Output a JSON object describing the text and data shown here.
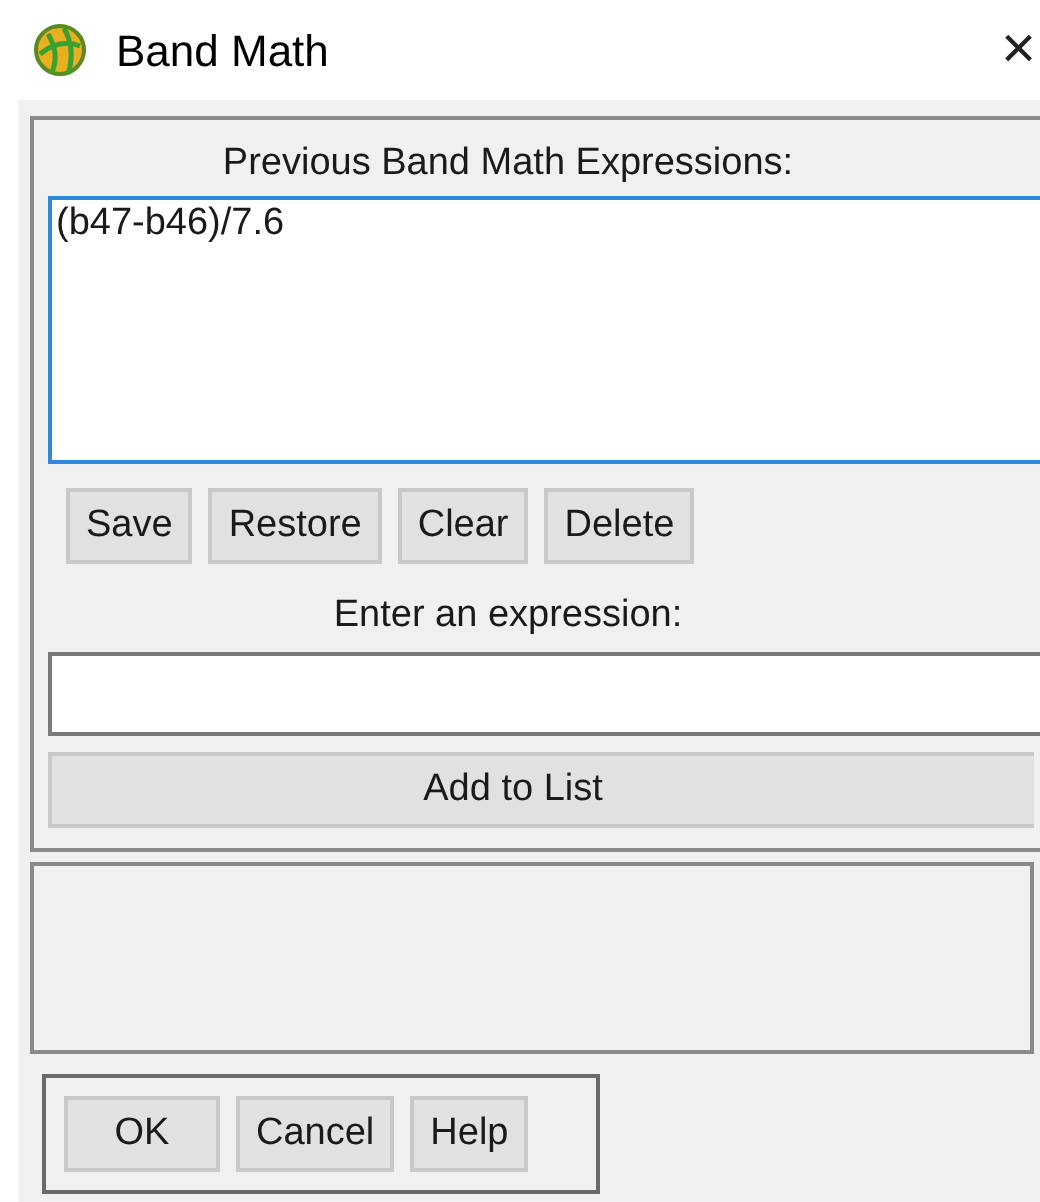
{
  "window": {
    "title": "Band Math",
    "close": "×"
  },
  "previous_expressions": {
    "label": "Previous Band Math Expressions:",
    "items": [
      "(b47-b46)/7.6"
    ]
  },
  "list_buttons": [
    "Save",
    "Restore",
    "Clear",
    "Delete"
  ],
  "expression": {
    "label": "Enter an expression:"
  },
  "add_button": "Add to List",
  "dialog_buttons": [
    "OK",
    "Cancel",
    "Help"
  ]
}
